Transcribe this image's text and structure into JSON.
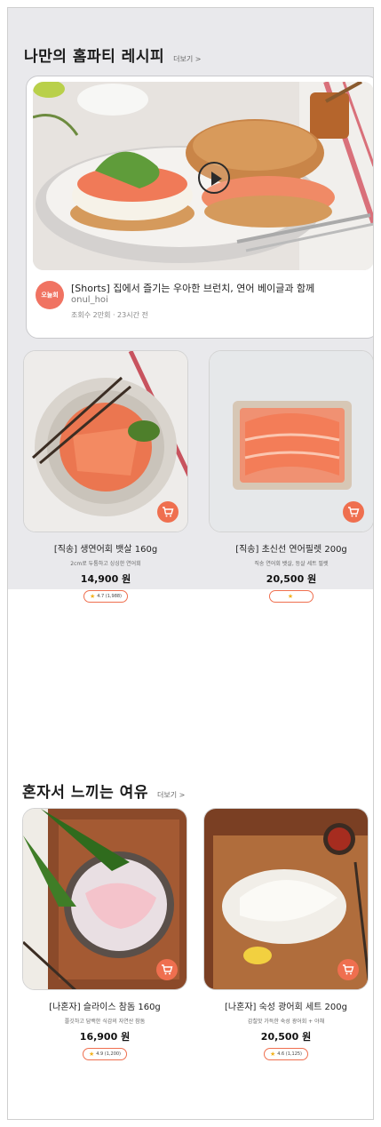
{
  "section_homeparty": {
    "title": "나만의 홈파티 레시피",
    "more": "더보기 >",
    "video": {
      "title": "[Shorts] 집에서 즐기는 우아한 브런치, 연어 베이글과 함께",
      "channel": "onul_hoi",
      "meta": "조회수 2만회 · 23시간 전",
      "avatar_text": "오늘회"
    },
    "products": [
      {
        "name": "[직송] 생연어회 뱃살 160g",
        "desc": "2cm로 두툼하고 싱싱한 연어회",
        "price": "14,900 원",
        "rating": "4.7 (1,988)"
      },
      {
        "name": "[직송] 초신선 연어필렛 200g",
        "desc": "직송 연어회 뱃살, 등살 세트 필렛",
        "price": "20,500 원",
        "rating": ""
      }
    ]
  },
  "section_solo": {
    "title": "혼자서 느끼는 여유",
    "more": "더보기 >",
    "products": [
      {
        "name": "[나혼자] 슬라이스 참돔 160g",
        "desc": "쫄깃하고 담백한 식감의 자연산 참돔",
        "price": "16,900 원",
        "rating": "4.9 (1,200)"
      },
      {
        "name": "[나혼자] 숙성 광어회 세트 200g",
        "desc": "감칠맛 가득한 숙성 광어회 + 야채",
        "price": "20,500 원",
        "rating": "4.6 (1,125)"
      }
    ]
  },
  "icons": {
    "cart": "cart-icon",
    "play": "play-icon",
    "star": "star-icon"
  },
  "colors": {
    "accent": "#ef6f4f",
    "section_bg": "#e9e9ec",
    "star": "#f2b21b"
  }
}
